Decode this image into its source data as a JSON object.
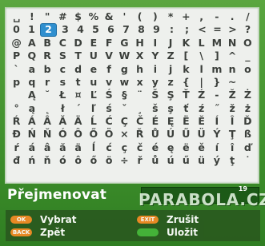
{
  "keyboard": {
    "rows": [
      [
        "␣",
        "!",
        "\"",
        "#",
        "$",
        "%",
        "&",
        "'",
        "(",
        ")",
        "*",
        "+",
        ",",
        "-",
        ".",
        "/"
      ],
      [
        "0",
        "1",
        "2",
        "3",
        "4",
        "5",
        "6",
        "7",
        "8",
        "9",
        ":",
        ";",
        "<",
        "=",
        ">",
        "?"
      ],
      [
        "@",
        "A",
        "B",
        "C",
        "D",
        "E",
        "F",
        "G",
        "H",
        "I",
        "J",
        "K",
        "L",
        "M",
        "N",
        "O"
      ],
      [
        "P",
        "Q",
        "R",
        "S",
        "T",
        "U",
        "V",
        "W",
        "X",
        "Y",
        "Z",
        "[",
        "\\",
        "]",
        "^",
        "_"
      ],
      [
        "`",
        "a",
        "b",
        "c",
        "d",
        "e",
        "f",
        "g",
        "h",
        "i",
        "j",
        "k",
        "l",
        "m",
        "n",
        "o"
      ],
      [
        "p",
        "q",
        "r",
        "s",
        "t",
        "u",
        "v",
        "w",
        "x",
        "y",
        "z",
        "{",
        "|",
        "}",
        "~",
        " "
      ],
      [
        " ",
        "Ą",
        "˘",
        "Ł",
        "¤",
        "Ľ",
        "Ś",
        "§",
        "¨",
        "Š",
        "Ş",
        "Ť",
        "Ź",
        "-",
        "Ž",
        "Ż"
      ],
      [
        "°",
        "ą",
        "˛",
        "ł",
        "´",
        "ľ",
        "ś",
        "ˇ",
        "¸",
        "š",
        "ş",
        "ť",
        "ź",
        "˝",
        "ž",
        "ż"
      ],
      [
        "Ŕ",
        "Á",
        "Â",
        "Ă",
        "Ä",
        "Ĺ",
        "Ć",
        "Ç",
        "Č",
        "É",
        "Ę",
        "Ë",
        "Ě",
        "Í",
        "Î",
        "Ď"
      ],
      [
        "Đ",
        "Ń",
        "Ň",
        "Ó",
        "Ô",
        "Ő",
        "Ö",
        "×",
        "Ř",
        "Ů",
        "Ú",
        "Ű",
        "Ü",
        "Ý",
        "Ţ",
        "ß"
      ],
      [
        "ŕ",
        "á",
        "â",
        "ă",
        "ä",
        "ĺ",
        "ć",
        "ç",
        "č",
        "é",
        "ę",
        "ë",
        "ě",
        "í",
        "î",
        "ď"
      ],
      [
        "đ",
        "ń",
        "ň",
        "ó",
        "ô",
        "ő",
        "ö",
        "÷",
        "ř",
        "ů",
        "ú",
        "ű",
        "ü",
        "ý",
        "ţ",
        "˙"
      ]
    ],
    "focused_key": "2"
  },
  "title": "Přejmenovat",
  "name_field": {
    "counter": "19"
  },
  "buttons": [
    {
      "pill": "OK",
      "label": "Vybrat",
      "color": "#f28a25"
    },
    {
      "pill": "BACK",
      "label": "Zpět",
      "color": "#f28a25"
    },
    {
      "pill": "EXIT",
      "label": "Zrušit",
      "color": "#f28a25"
    },
    {
      "pill": "",
      "label": "Uložit",
      "color": "#46b53a"
    }
  ],
  "watermark": "PARABOLA.CZ"
}
